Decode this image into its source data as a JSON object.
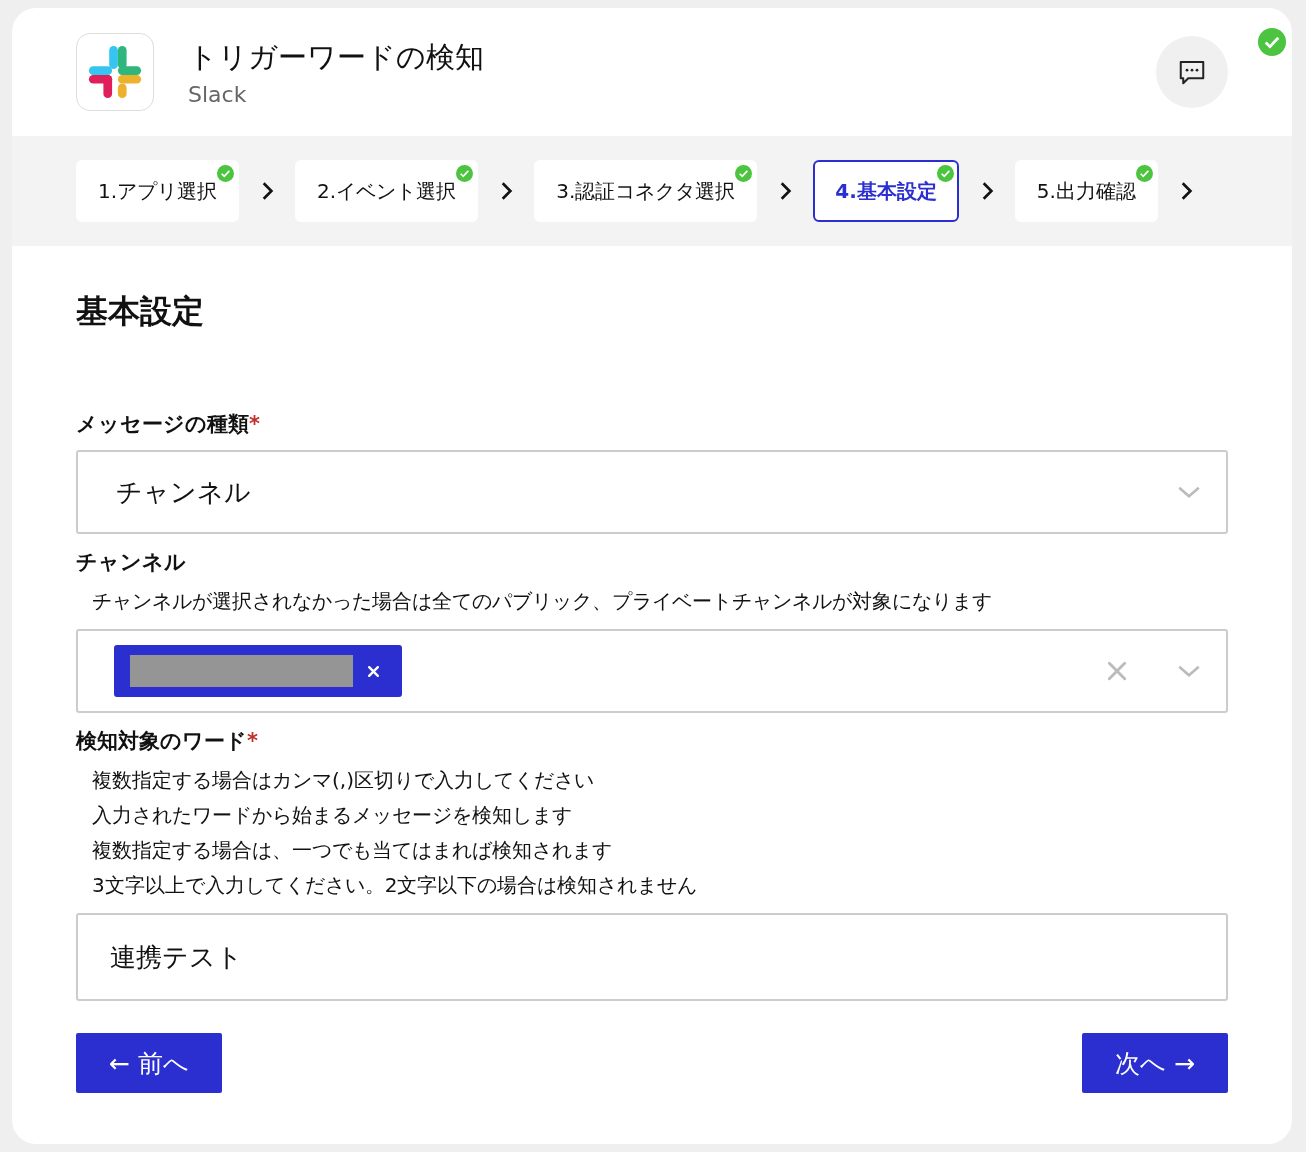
{
  "header": {
    "title": "トリガーワードの検知",
    "subtitle": "Slack",
    "status_done": true
  },
  "steps": [
    {
      "label": "1.アプリ選択",
      "selected": false,
      "done": true
    },
    {
      "label": "2.イベント選択",
      "selected": false,
      "done": true
    },
    {
      "label": "3.認証コネクタ選択",
      "selected": false,
      "done": true
    },
    {
      "label": "4.基本設定",
      "selected": true,
      "done": true
    },
    {
      "label": "5.出力確認",
      "selected": false,
      "done": true
    }
  ],
  "section_title": "基本設定",
  "fields": [
    {
      "kind": "select",
      "label": "メッセージの種類",
      "required_mark": "*",
      "value": "チャンネル"
    },
    {
      "kind": "multiselect",
      "label": "チャンネル",
      "help": [
        "チャンネルが選択されなかった場合は全てのパブリック、プライベートチャンネルが対象になります"
      ],
      "tags": [
        {
          "redacted": true
        }
      ]
    },
    {
      "kind": "text",
      "label": "検知対象のワード",
      "required_mark": "*",
      "help": [
        "複数指定する場合はカンマ(,)区切りで入力してください",
        "入力されたワードから始まるメッセージを検知します",
        "複数指定する場合は、一つでも当てはまれば検知されます",
        "3文字以上で入力してください。2文字以下の場合は検知されません"
      ],
      "value": "連携テスト"
    }
  ],
  "buttons": {
    "back": "← 前へ",
    "next": "次へ →"
  }
}
